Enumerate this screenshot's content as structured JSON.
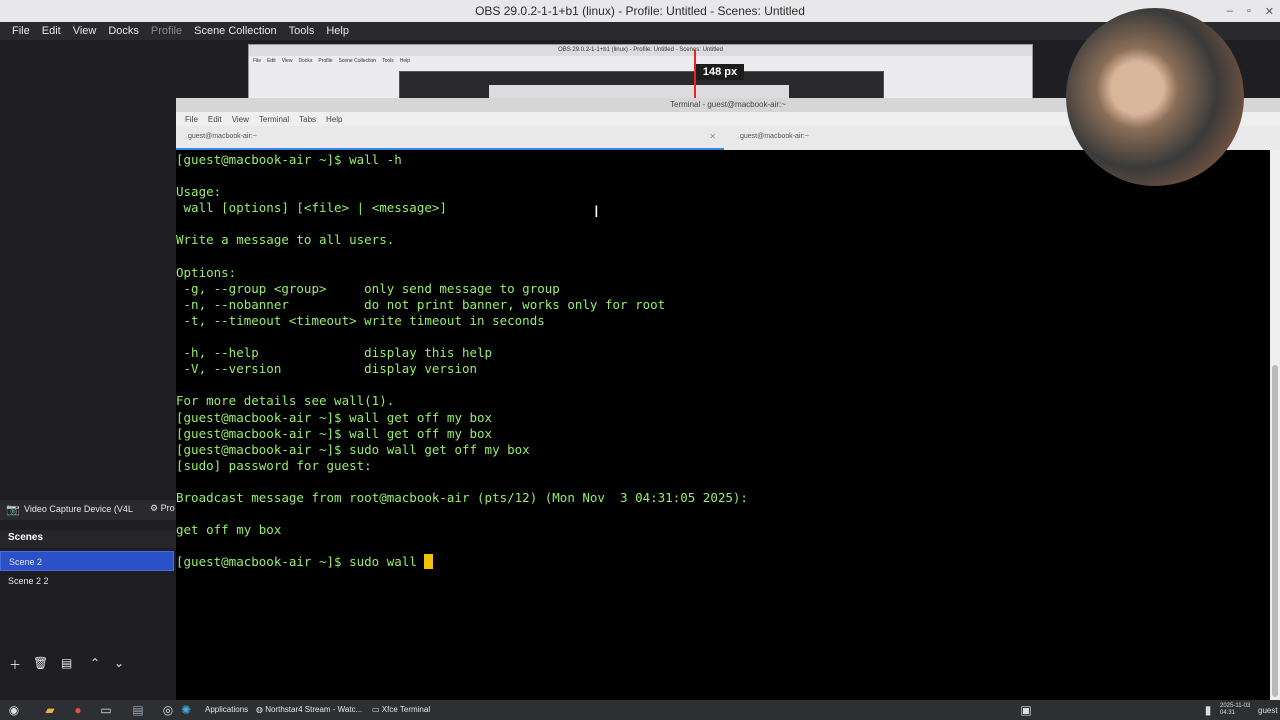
{
  "obs": {
    "title": "OBS 29.0.2-1-1+b1 (linux) - Profile: Untitled - Scenes: Untitled",
    "menu": [
      "File",
      "Edit",
      "View",
      "Docks",
      "Profile",
      "Scene Collection",
      "Tools",
      "Help"
    ],
    "preview_title": "OBS 29.0.2-1-1+b1 (linux) - Profile: Untitled - Scenes: Untitled",
    "preview_menu": [
      "File",
      "Edit",
      "View",
      "Docks",
      "Profile",
      "Scene Collection",
      "Tools",
      "Help"
    ],
    "px_label": "148 px",
    "source_label": "Video Capture Device (V4L",
    "props_label": "Pro",
    "scenes_title": "Scenes",
    "scenes": [
      "Scene 2",
      "Scene 2 2"
    ],
    "selected_scene": "Scene 2"
  },
  "terminal": {
    "title": "Terminal - guest@macbook-air:~",
    "menu": [
      "File",
      "Edit",
      "View",
      "Terminal",
      "Tabs",
      "Help"
    ],
    "tabs": [
      "guest@macbook-air:~",
      "guest@macbook-air:~"
    ],
    "lines": [
      "[guest@macbook-air ~]$ wall -h",
      "",
      "Usage:",
      " wall [options] [<file> | <message>]",
      "",
      "Write a message to all users.",
      "",
      "Options:",
      " -g, --group <group>     only send message to group",
      " -n, --nobanner          do not print banner, works only for root",
      " -t, --timeout <timeout> write timeout in seconds",
      "",
      " -h, --help              display this help",
      " -V, --version           display version",
      "",
      "For more details see wall(1).",
      "[guest@macbook-air ~]$ wall get off my box",
      "[guest@macbook-air ~]$ wall get off my box",
      "[guest@macbook-air ~]$ sudo wall get off my box",
      "[sudo] password for guest:",
      "",
      "Broadcast message from root@macbook-air (pts/12) (Mon Nov  3 04:31:05 2025):",
      "",
      "get off my box",
      ""
    ],
    "prompt_line": "[guest@macbook-air ~]$ sudo wall "
  },
  "taskbar": {
    "applications": "Applications",
    "task1": "Northstar4 Stream - Watc...",
    "task2": "Xfce Terminal",
    "date": "2025-11-03",
    "time": "04:31",
    "user": "guest"
  },
  "colors": {
    "terminal_text": "#97ee6a",
    "cursor": "#f2c200",
    "selected_scene": "#2c50c8"
  }
}
